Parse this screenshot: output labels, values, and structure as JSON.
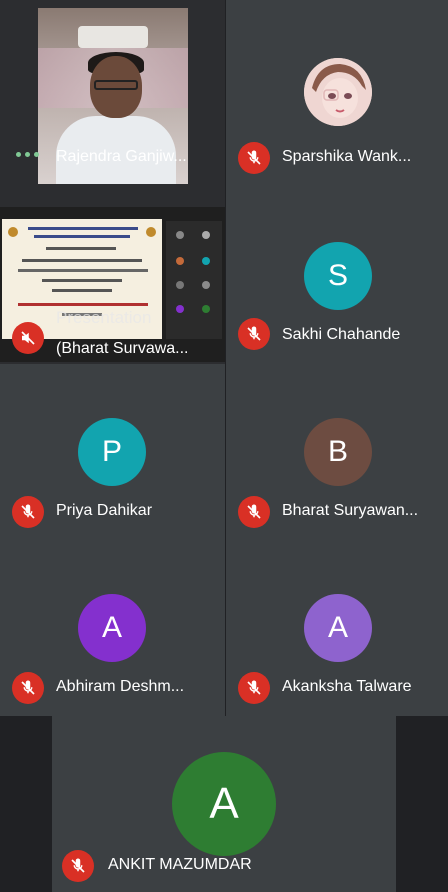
{
  "participants": {
    "rajendra": {
      "name": "Rajendra Ganjiw...",
      "status": "speaking"
    },
    "sparshika": {
      "name": "Sparshika Wank...",
      "avatar_kind": "photo"
    },
    "presentation": {
      "label": "Presentation",
      "name": "(Bharat Survawa..."
    },
    "sakhi": {
      "name": "Sakhi Chahande",
      "initial": "S",
      "color": "#12a4af"
    },
    "priya": {
      "name": "Priya Dahikar",
      "initial": "P",
      "color": "#12a4af"
    },
    "bharat": {
      "name": "Bharat Suryawan...",
      "initial": "B",
      "color": "#6d4c41"
    },
    "abhiram": {
      "name": "Abhiram Deshm...",
      "initial": "A",
      "color": "#8430ce"
    },
    "akanksha": {
      "name": "Akanksha Talware",
      "initial": "A",
      "color": "#8e63ce"
    },
    "ankit": {
      "name": "ANKIT MAZUMDAR",
      "initial": "A",
      "color": "#2e7d32"
    }
  },
  "icons": {
    "muted": "mic-off-icon",
    "activity": "more-dots-icon",
    "presentation_muted": "volume-off-icon"
  },
  "colors": {
    "background": "#202124",
    "tile": "#3c4043",
    "muted_badge": "#d93025"
  }
}
